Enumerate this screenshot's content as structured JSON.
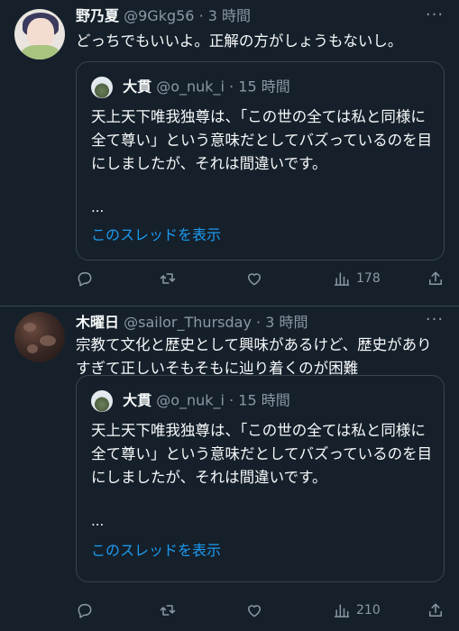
{
  "tweets": [
    {
      "name": "野乃夏",
      "handle": "@9Gkg56",
      "sep": "·",
      "time": "3 時間",
      "more": "···",
      "text": "どっちでもいいよ。正解の方がしょうもないし。",
      "quote": {
        "name": "大貫",
        "handle": "@o_nuk_i",
        "sep": "·",
        "time": "15 時間",
        "text": "天上天下唯我独尊は、「この世の全ては私と同様に全て尊い」という意味だとしてバズっているのを目にしましたが、それは間違いです。",
        "ellipsis": "...",
        "link": "このスレッドを表示"
      },
      "views": "178"
    },
    {
      "name": "木曜日",
      "handle": "@sailor_Thursday",
      "sep": "·",
      "time": "3 時間",
      "more": "···",
      "text": "宗教て文化と歴史として興味があるけど、歴史がありすぎて正しいそもそもに辿り着くのが困難",
      "quote": {
        "name": "大貫",
        "handle": "@o_nuk_i",
        "sep": "·",
        "time": "15 時間",
        "text": "天上天下唯我独尊は、「この世の全ては私と同様に全て尊い」という意味だとしてバズっているのを目にしましたが、それは間違いです。",
        "ellipsis": "...",
        "link": "このスレッドを表示"
      },
      "views": "210"
    }
  ],
  "icons": [
    "reply-icon",
    "retweet-icon",
    "like-icon",
    "views-icon",
    "share-icon"
  ],
  "colors": {
    "background": "#15202b",
    "text": "#f7f9f9",
    "muted": "#8b98a5",
    "link": "#1d9bf0",
    "border": "#38444d"
  }
}
